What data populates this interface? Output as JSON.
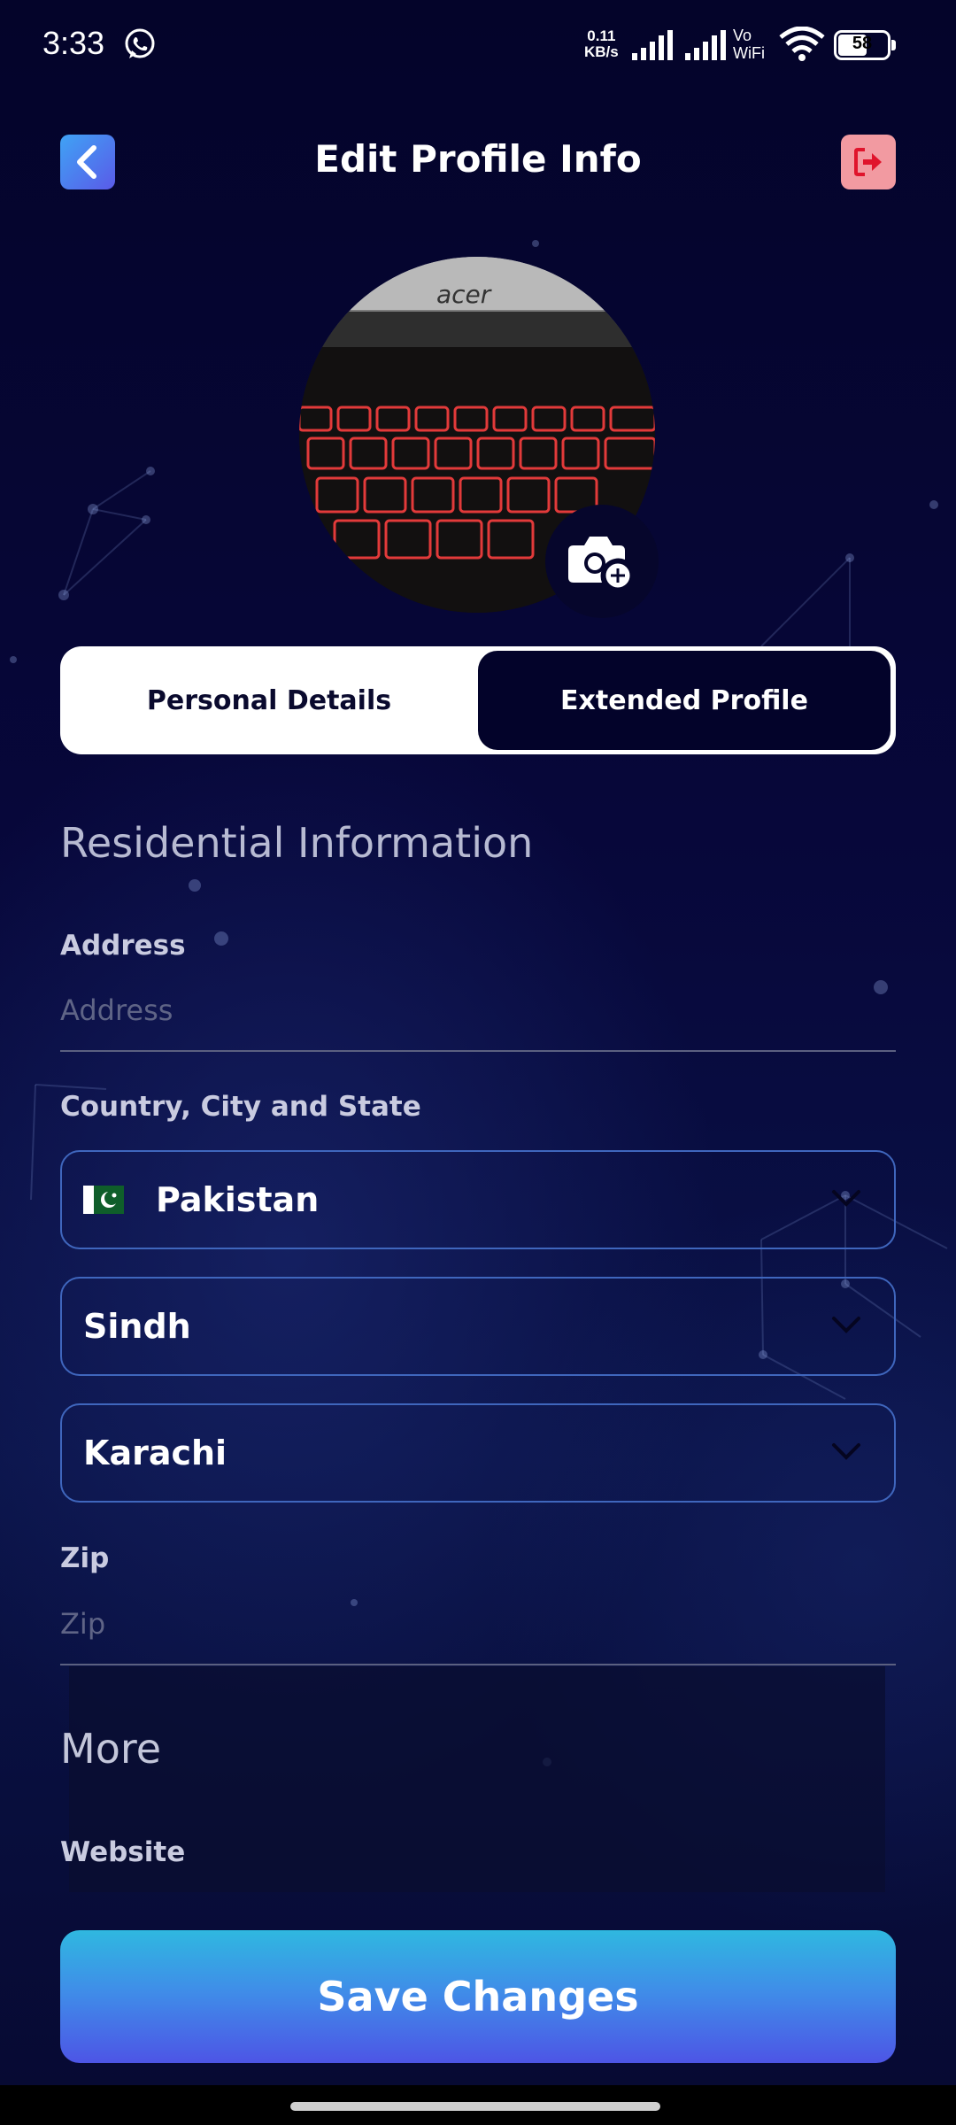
{
  "status_bar": {
    "time": "3:33",
    "net_speed": "0.11",
    "net_unit": "KB/s",
    "vowifi_top": "Vo",
    "vowifi_bottom": "WiFi",
    "battery": "58"
  },
  "header": {
    "title": "Edit Profile Info"
  },
  "tabs": [
    {
      "label": "Personal Details",
      "active": false
    },
    {
      "label": "Extended Profile",
      "active": true
    }
  ],
  "residential": {
    "heading": "Residential Information",
    "address_label": "Address",
    "address_placeholder": "Address",
    "location_label": "Country, City and State",
    "country": "Pakistan",
    "state": "Sindh",
    "city": "Karachi",
    "zip_label": "Zip",
    "zip_placeholder": "Zip"
  },
  "more": {
    "heading": "More",
    "website_label": "Website"
  },
  "actions": {
    "save_label": "Save Changes"
  },
  "colors": {
    "background": "#05052a",
    "accent_blue": "#3f66bd",
    "save_gradient_top": "#2fb8e0",
    "save_gradient_bottom": "#4d55e6",
    "logout_bg": "#f29aa1"
  }
}
